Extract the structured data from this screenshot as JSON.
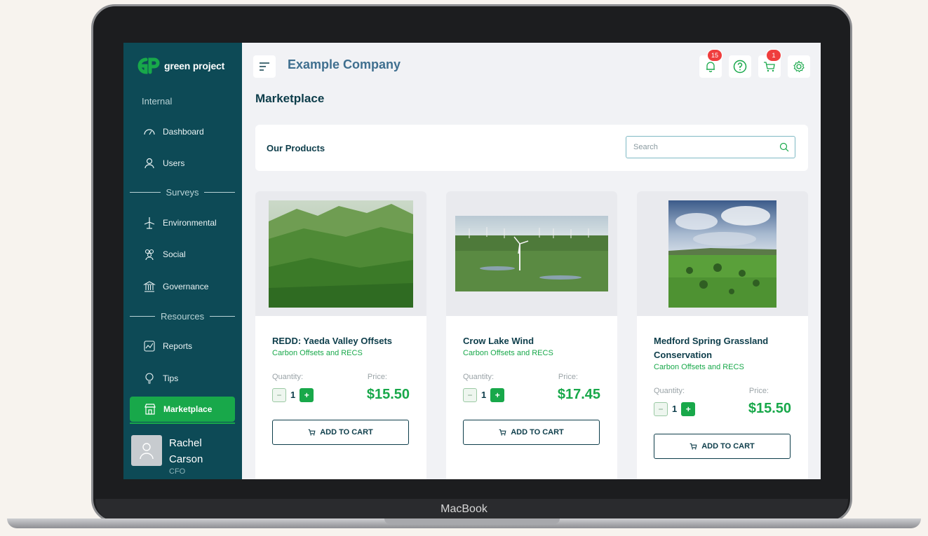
{
  "device": {
    "brand_label": "MacBook"
  },
  "sidebar": {
    "logo_text": "green project",
    "section_internal": "Internal",
    "items_internal": [
      {
        "label": "Dashboard",
        "icon": "gauge-icon"
      },
      {
        "label": "Users",
        "icon": "user-icon"
      }
    ],
    "section_surveys": "Surveys",
    "items_surveys": [
      {
        "label": "Environmental",
        "icon": "wind-turbine-icon"
      },
      {
        "label": "Social",
        "icon": "people-icon"
      },
      {
        "label": "Governance",
        "icon": "bank-icon"
      }
    ],
    "section_resources": "Resources",
    "items_resources": [
      {
        "label": "Reports",
        "icon": "report-icon"
      },
      {
        "label": "Tips",
        "icon": "lightbulb-icon"
      }
    ],
    "active_item": {
      "label": "Marketplace",
      "icon": "store-icon"
    },
    "user": {
      "first_name": "Rachel",
      "last_name": "Carson",
      "role": "CFO"
    }
  },
  "header": {
    "company": "Example Company",
    "notifications_count": "15",
    "cart_count": "1"
  },
  "page": {
    "title": "Marketplace",
    "section_title": "Our Products",
    "search_placeholder": "Search"
  },
  "products": [
    {
      "title": "REDD: Yaeda Valley Offsets",
      "category": "Carbon Offsets and RECS",
      "quantity_label": "Quantity:",
      "price_label": "Price:",
      "quantity": "1",
      "price": "$15.50",
      "cta": "ADD TO CART"
    },
    {
      "title": "Crow Lake Wind",
      "category": "Carbon Offsets and RECS",
      "quantity_label": "Quantity:",
      "price_label": "Price:",
      "quantity": "1",
      "price": "$17.45",
      "cta": "ADD TO CART"
    },
    {
      "title": "Medford Spring Grassland Conservation",
      "category": "Carbon Offsets and RECS",
      "quantity_label": "Quantity:",
      "price_label": "Price:",
      "quantity": "1",
      "price": "$15.50",
      "cta": "ADD TO CART"
    }
  ],
  "colors": {
    "sidebar": "#0d4a56",
    "accent": "#18a84a",
    "heading": "#0d3d4a",
    "badge": "#ef3d3d"
  }
}
